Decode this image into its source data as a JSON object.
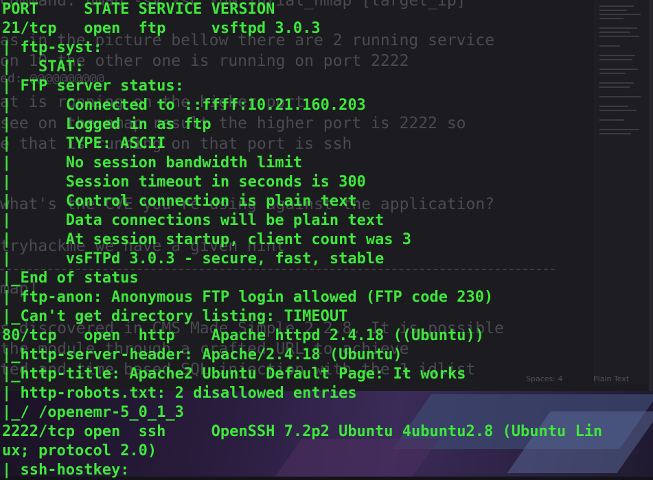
{
  "editor": {
    "background_lines": [
      "Command: nmap -sV -sC -oN intial_nmap [target_ip]",
      "as in the picture bellow there are 2 running service",
      "on 10 the other one is running on port 2222",
      "ed: @@@@@@@@@@",
      "at is running on the higher port",
      "see on the nmap result the higher port is 2222 so",
      "e that is running on that port is ssh",
      "what's the CVE you're using against the application?",
      "tryhackme we have a given hint",
      "map]",
      "s discovered in CMS Made Simple 2.2.8. It is possible",
      "the module through a crafted URL to achieve",
      "ted and time based SQL injection with the 1 idlist"
    ],
    "status_spaces": "Spaces: 4",
    "status_language": "Plain Text"
  },
  "terminal": {
    "lines": [
      "PORT     STATE SERVICE VERSION",
      "21/tcp   open  ftp     vsftpd 3.0.3",
      "| ftp-syst:",
      "|   STAT:",
      "| FTP server status:",
      "|      Connected to ::ffff:10.21.160.203",
      "|      Logged in as ftp",
      "|      TYPE: ASCII",
      "|      No session bandwidth limit",
      "|      Session timeout in seconds is 300",
      "|      Control connection is plain text",
      "|      Data connections will be plain text",
      "|      At session startup, client count was 3",
      "|      vsFTPd 3.0.3 - secure, fast, stable",
      "|_End of status",
      "| ftp-anon: Anonymous FTP login allowed (FTP code 230)",
      "|_Can't get directory listing: TIMEOUT",
      "80/tcp   open  http    Apache httpd 2.4.18 ((Ubuntu))",
      "|_http-server-header: Apache/2.4.18 (Ubuntu)",
      "|_http-title: Apache2 Ubuntu Default Page: It works",
      "| http-robots.txt: 2 disallowed entries",
      "|_/ /openemr-5_0_1_3",
      "2222/tcp open  ssh     OpenSSH 7.2p2 Ubuntu 4ubuntu2.8 (Ubuntu Lin",
      "ux; protocol 2.0)",
      "| ssh-hostkey:"
    ]
  },
  "colors": {
    "terminal_text": "#3ee83a",
    "editor_bg": "#1c1c20",
    "faint_text": "#4a4a52"
  }
}
